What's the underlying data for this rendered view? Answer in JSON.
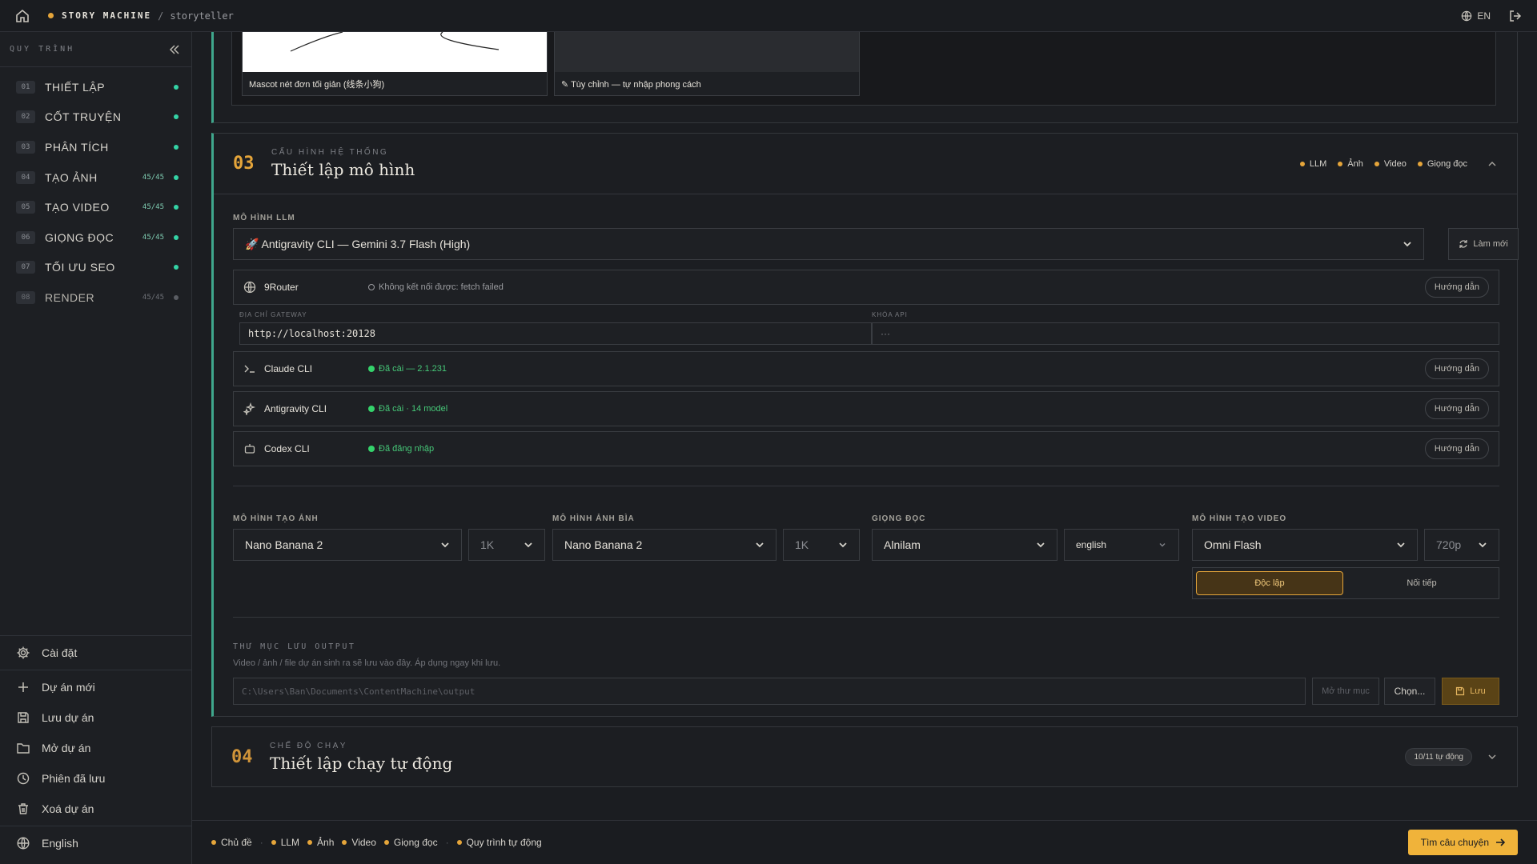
{
  "topbar": {
    "brand": "STORY MACHINE",
    "separator": "/",
    "project": "storyteller",
    "lang": "EN"
  },
  "sidebar": {
    "header": "QUY TRÌNH",
    "steps": [
      {
        "num": "01",
        "label": "THIẾT LẬP",
        "count": "",
        "status": "done"
      },
      {
        "num": "02",
        "label": "CỐT TRUYỆN",
        "count": "",
        "status": "done"
      },
      {
        "num": "03",
        "label": "PHÂN TÍCH",
        "count": "",
        "status": "done"
      },
      {
        "num": "04",
        "label": "TẠO ẢNH",
        "count": "45/45",
        "status": "done"
      },
      {
        "num": "05",
        "label": "TẠO VIDEO",
        "count": "45/45",
        "status": "done"
      },
      {
        "num": "06",
        "label": "GIỌNG ĐỌC",
        "count": "45/45",
        "status": "done"
      },
      {
        "num": "07",
        "label": "TỐI ƯU SEO",
        "count": "",
        "status": "done"
      },
      {
        "num": "08",
        "label": "RENDER",
        "count": "45/45",
        "status": "pending"
      }
    ],
    "settings": "Cài đặt",
    "actions": [
      "Dự án mới",
      "Lưu dự án",
      "Mở dự án",
      "Phiên đã lưu",
      "Xoá dự án"
    ],
    "language": "English"
  },
  "style_tiles": [
    {
      "caption": "Mascot nét đơn tối giản (线条小狗)"
    },
    {
      "caption": "✎ Tùy chỉnh — tự nhập phong cách"
    }
  ],
  "section3": {
    "number": "03",
    "eyebrow": "CẤU HÌNH HỆ THỐNG",
    "title": "Thiết lập mô hình",
    "tags": [
      "LLM",
      "Ảnh",
      "Video",
      "Giọng đọc"
    ],
    "llm_label": "MÔ HÌNH LLM",
    "llm_value": "🚀  Antigravity CLI — Gemini 3.7 Flash (High)",
    "refresh": "Làm mới",
    "providers": [
      {
        "name": "9Router",
        "status": "Không kết nối được: fetch failed",
        "ok": false,
        "guide": "Hướng dẫn"
      },
      {
        "name": "Claude CLI",
        "status": "Đã cài — 2.1.231",
        "ok": true,
        "guide": "Hướng dẫn"
      },
      {
        "name": "Antigravity CLI",
        "status": "Đã cài · 14 model",
        "ok": true,
        "guide": "Hướng dẫn"
      },
      {
        "name": "Codex CLI",
        "status": "Đã đăng nhập",
        "ok": true,
        "guide": "Hướng dẫn"
      }
    ],
    "gateway_label": "ĐỊA CHỈ GATEWAY",
    "gateway_value": "http://localhost:20128",
    "apikey_label": "KHÓA API",
    "apikey_value": "···",
    "image_model_label": "MÔ HÌNH TẠO ẢNH",
    "image_model": "Nano Banana 2",
    "image_res": "1K",
    "cover_model_label": "MÔ HÌNH ẢNH BÌA",
    "cover_model": "Nano Banana 2",
    "cover_res": "1K",
    "voice_label": "GIỌNG ĐỌC",
    "voice": "Alnilam",
    "voice_lang": "english",
    "video_model_label": "MÔ HÌNH TẠO VIDEO",
    "video_model": "Omni Flash",
    "video_res": "720p",
    "mode_on": "Độc lập",
    "mode_off": "Nối tiếp",
    "output_label": "THƯ MỤC LƯU OUTPUT",
    "output_hint": "Video / ảnh / file dự án sinh ra sẽ lưu vào đây. Áp dụng ngay khi lưu.",
    "output_placeholder": "C:\\Users\\Ban\\Documents\\ContentMachine\\output",
    "open_folder": "Mở thư mục",
    "choose": "Chọn...",
    "save": "Lưu"
  },
  "section4": {
    "number": "04",
    "eyebrow": "CHẾ ĐỘ CHẠY",
    "title": "Thiết lập chạy tự động",
    "badge": "10/11 tự động"
  },
  "footer": {
    "crumbs": [
      "Chủ đề",
      "LLM",
      "Ảnh",
      "Video",
      "Giọng đọc",
      "Quy trình tự động"
    ],
    "cta": "Tìm câu chuyện"
  },
  "colors": {
    "accent": "#e5a53a",
    "ok": "#34d3a6",
    "section_bar": "#3fa78c"
  }
}
